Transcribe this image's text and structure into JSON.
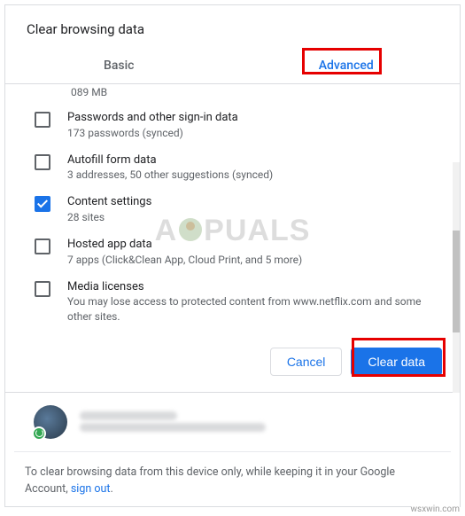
{
  "title": "Clear browsing data",
  "tabs": {
    "basic": "Basic",
    "advanced": "Advanced",
    "active": "advanced"
  },
  "truncated_top": "089 MB",
  "items": [
    {
      "checked": false,
      "title": "Passwords and other sign-in data",
      "sub": "173 passwords (synced)"
    },
    {
      "checked": false,
      "title": "Autofill form data",
      "sub": "3 addresses, 50 other suggestions (synced)"
    },
    {
      "checked": true,
      "title": "Content settings",
      "sub": "28 sites"
    },
    {
      "checked": false,
      "title": "Hosted app data",
      "sub": "7 apps (Click&Clean App, Cloud Print, and 5 more)"
    },
    {
      "checked": false,
      "title": "Media licenses",
      "sub": "You may lose access to protected content from www.netflix.com and some other sites."
    }
  ],
  "buttons": {
    "cancel": "Cancel",
    "clear": "Clear data"
  },
  "footer": {
    "text": "To clear browsing data from this device only, while keeping it in your Google Account, ",
    "link": "sign out",
    "period": "."
  },
  "watermark_text": "A   PUALS",
  "source": "wsxwin.com"
}
